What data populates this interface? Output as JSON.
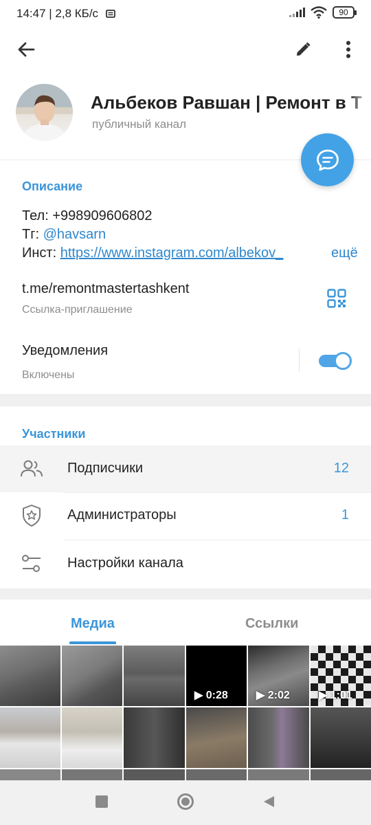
{
  "status_bar": {
    "time": "14:47 | 2,8 КБ/с",
    "battery": "90"
  },
  "toolbar": {
    "back_icon": "arrow-left-icon",
    "edit_icon": "pencil-icon",
    "more_icon": "more-vertical-icon"
  },
  "channel": {
    "name": "Альбеков Равшан | Ремонт в Т",
    "type": "публичный канал"
  },
  "description": {
    "title": "Описание",
    "phone_line": "Тел: +998909606802",
    "tg_prefix": "Тг: ",
    "tg_handle": "@havsarn",
    "inst_prefix": "Инст: ",
    "inst_link": "https://www.instagram.com/albekov_",
    "more": "ещё"
  },
  "invite": {
    "link": "t.me/remontmastertashkent",
    "label": "Ссылка-приглашение"
  },
  "notifications": {
    "title": "Уведомления",
    "status": "Включены",
    "enabled": true
  },
  "members": {
    "title": "Участники",
    "rows": [
      {
        "label": "Подписчики",
        "count": "12",
        "icon": "users-icon"
      },
      {
        "label": "Администраторы",
        "count": "1",
        "icon": "shield-star-icon"
      },
      {
        "label": "Настройки канала",
        "count": "",
        "icon": "sliders-icon"
      }
    ]
  },
  "tabs": [
    {
      "label": "Медиа",
      "active": true
    },
    {
      "label": "Ссылки",
      "active": false
    }
  ],
  "media": {
    "durations": [
      "0:28",
      "2:02",
      "1:01"
    ]
  },
  "colors": {
    "accent": "#3b95d9",
    "fab": "#43a2e6"
  }
}
